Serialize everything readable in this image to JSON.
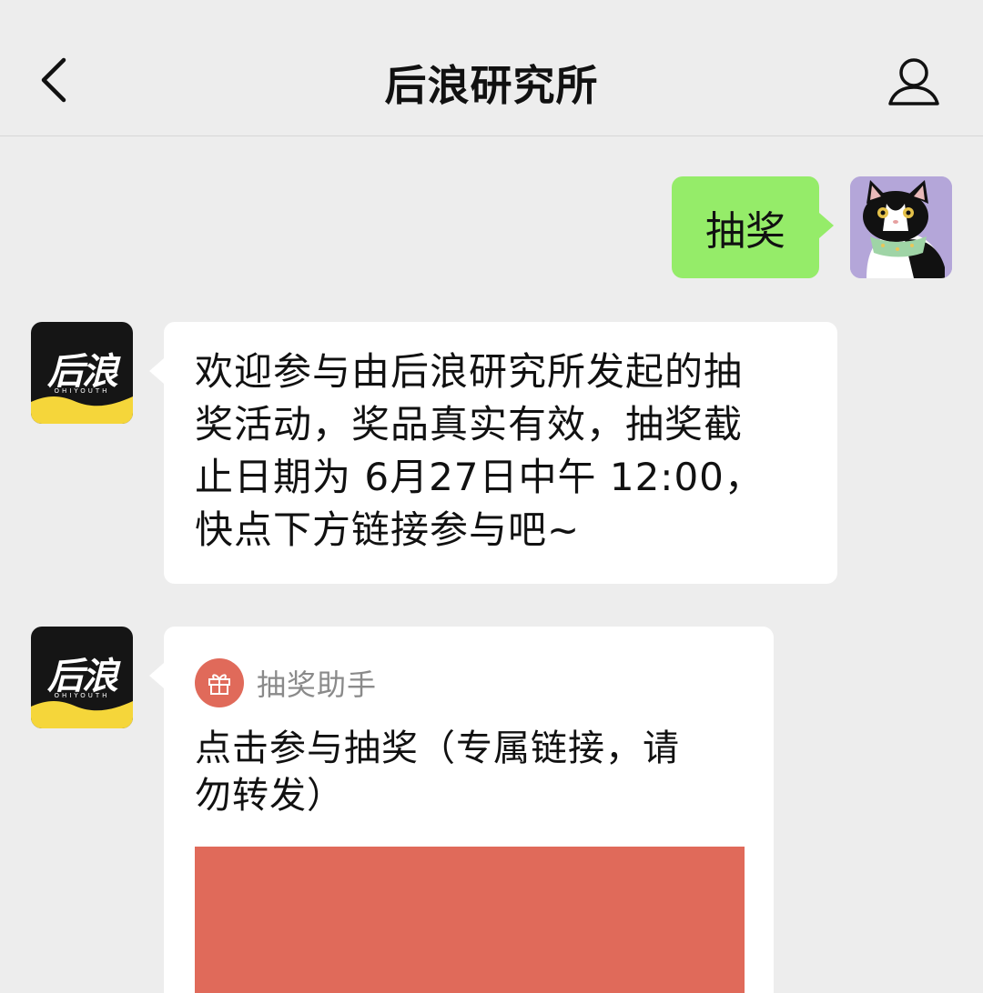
{
  "header": {
    "title": "后浪研究所",
    "back_icon": "chevron-left-icon",
    "profile_icon": "person-icon"
  },
  "messages": {
    "user": {
      "text": "抽奖",
      "avatar": "cat-avatar"
    },
    "bot_text": {
      "avatar_logo": "后浪",
      "avatar_sub": "OHIYOUTH",
      "lines": [
        "欢迎参与由后浪研究所发起的抽",
        "奖活动，奖品真实有效，抽奖截",
        "止日期为 6月27日中午 12:00，",
        "快点下方链接参与吧~"
      ]
    },
    "bot_card": {
      "avatar_logo": "后浪",
      "avatar_sub": "OHIYOUTH",
      "app_name": "抽奖助手",
      "app_icon": "gift-icon",
      "title_lines": [
        "点击参与抽奖（专属链接，请",
        "勿转发）"
      ]
    }
  },
  "colors": {
    "background": "#ededed",
    "user_bubble": "#95ec69",
    "bot_bubble": "#ffffff",
    "card_accent": "#e06a5a",
    "logo_yellow": "#f5d63a"
  }
}
